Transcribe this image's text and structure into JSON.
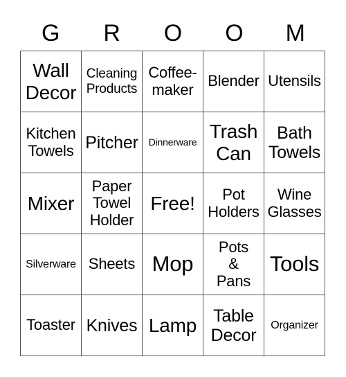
{
  "card": {
    "header": [
      "G",
      "R",
      "O",
      "O",
      "M"
    ],
    "rows": [
      [
        {
          "text": "Wall\nDecor",
          "size": "l"
        },
        {
          "text": "Cleaning\nProducts",
          "size": "s"
        },
        {
          "text": "Coffee-\nmaker",
          "size": "m"
        },
        {
          "text": "Blender",
          "size": "m"
        },
        {
          "text": "Utensils",
          "size": "m"
        }
      ],
      [
        {
          "text": "Kitchen\nTowels",
          "size": "m"
        },
        {
          "text": "Pitcher",
          "size": "ml"
        },
        {
          "text": "Dinnerware",
          "size": "xxs"
        },
        {
          "text": "Trash\nCan",
          "size": "l"
        },
        {
          "text": "Bath\nTowels",
          "size": "ml"
        }
      ],
      [
        {
          "text": "Mixer",
          "size": "l"
        },
        {
          "text": "Paper\nTowel\nHolder",
          "size": "m"
        },
        {
          "text": "Free!",
          "size": "l"
        },
        {
          "text": "Pot\nHolders",
          "size": "m"
        },
        {
          "text": "Wine\nGlasses",
          "size": "m"
        }
      ],
      [
        {
          "text": "Silverware",
          "size": "xs"
        },
        {
          "text": "Sheets",
          "size": "m"
        },
        {
          "text": "Mop",
          "size": "xl"
        },
        {
          "text": "Pots\n&\nPans",
          "size": "m"
        },
        {
          "text": "Tools",
          "size": "xl"
        }
      ],
      [
        {
          "text": "Toaster",
          "size": "m"
        },
        {
          "text": "Knives",
          "size": "ml"
        },
        {
          "text": "Lamp",
          "size": "l"
        },
        {
          "text": "Table\nDecor",
          "size": "ml"
        },
        {
          "text": "Organizer",
          "size": "xs"
        }
      ]
    ]
  }
}
